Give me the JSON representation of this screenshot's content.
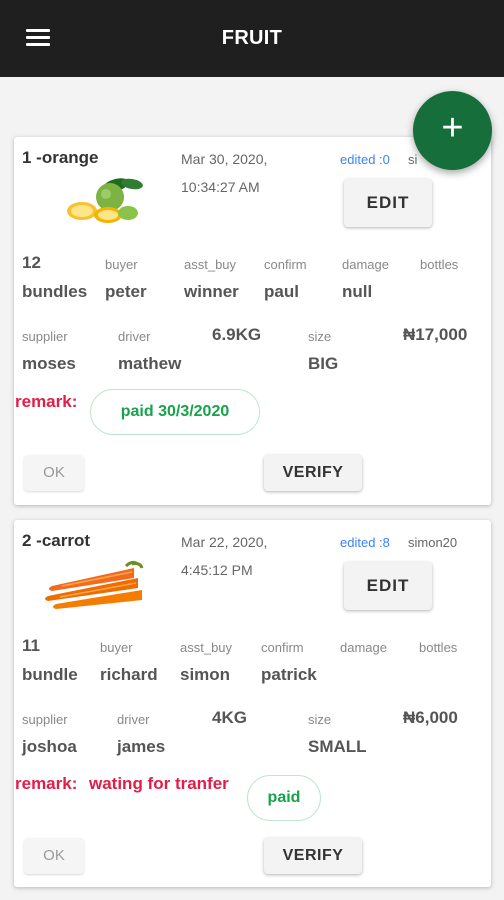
{
  "appbar": {
    "title": "FRUIT"
  },
  "fab": {
    "label": "+"
  },
  "cards": [
    {
      "title": "1 -orange",
      "date_line1": "Mar 30, 2020,",
      "date_line2": "10:34:27 AM",
      "edited": "edited :0",
      "editor": "si",
      "edit_label": "EDIT",
      "qty_num": "12",
      "qty_unit": "bundles",
      "buyer_label": "buyer",
      "buyer": "peter",
      "asst_buy_label": "asst_buy",
      "asst_buy": "winner",
      "confirm_label": "confirm",
      "confirm": "paul",
      "damage_label": "damage",
      "damage": "null",
      "bottles_label": "bottles",
      "supplier_label": "supplier",
      "supplier": "moses",
      "driver_label": "driver",
      "driver": "mathew",
      "weight": "6.9KG",
      "size_label": "size",
      "size": "BIG",
      "price": "₦17,000",
      "remark_label": "remark:",
      "remark_text": "",
      "status": "paid 30/3/2020",
      "ok_label": "OK",
      "verify_label": "VERIFY"
    },
    {
      "title": "2 -carrot",
      "date_line1": "Mar 22, 2020,",
      "date_line2": "4:45:12 PM",
      "edited": "edited :8",
      "editor": "simon20",
      "edit_label": "EDIT",
      "qty_num": "11",
      "qty_unit": "bundle",
      "buyer_label": "buyer",
      "buyer": "richard",
      "asst_buy_label": "asst_buy",
      "asst_buy": "simon",
      "confirm_label": "confirm",
      "confirm": "patrick",
      "damage_label": "damage",
      "bottles_label": "bottles",
      "supplier_label": "supplier",
      "supplier": "joshoa",
      "driver_label": "driver",
      "driver": "james",
      "weight": "4KG",
      "size_label": "size",
      "size": "SMALL",
      "price": "₦6,000",
      "remark_label": "remark:",
      "remark_text": "wating for tranfer",
      "status": "paid",
      "ok_label": "OK",
      "verify_label": "VERIFY"
    }
  ]
}
